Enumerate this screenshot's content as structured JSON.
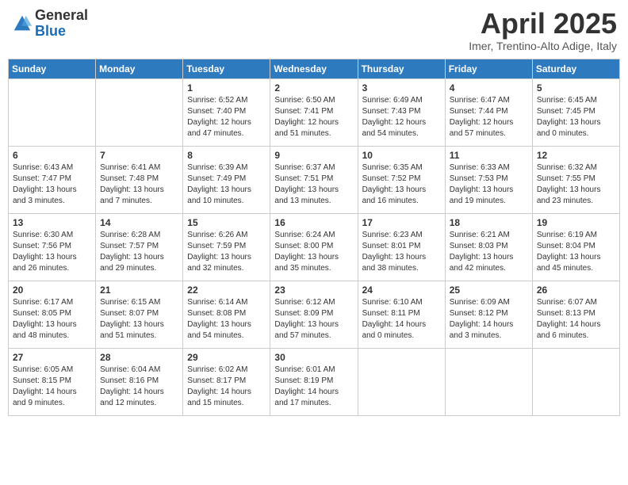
{
  "header": {
    "logo_general": "General",
    "logo_blue": "Blue",
    "month_title": "April 2025",
    "location": "Imer, Trentino-Alto Adige, Italy"
  },
  "days_of_week": [
    "Sunday",
    "Monday",
    "Tuesday",
    "Wednesday",
    "Thursday",
    "Friday",
    "Saturday"
  ],
  "weeks": [
    [
      {
        "day": "",
        "info": ""
      },
      {
        "day": "",
        "info": ""
      },
      {
        "day": "1",
        "info": "Sunrise: 6:52 AM\nSunset: 7:40 PM\nDaylight: 12 hours and 47 minutes."
      },
      {
        "day": "2",
        "info": "Sunrise: 6:50 AM\nSunset: 7:41 PM\nDaylight: 12 hours and 51 minutes."
      },
      {
        "day": "3",
        "info": "Sunrise: 6:49 AM\nSunset: 7:43 PM\nDaylight: 12 hours and 54 minutes."
      },
      {
        "day": "4",
        "info": "Sunrise: 6:47 AM\nSunset: 7:44 PM\nDaylight: 12 hours and 57 minutes."
      },
      {
        "day": "5",
        "info": "Sunrise: 6:45 AM\nSunset: 7:45 PM\nDaylight: 13 hours and 0 minutes."
      }
    ],
    [
      {
        "day": "6",
        "info": "Sunrise: 6:43 AM\nSunset: 7:47 PM\nDaylight: 13 hours and 3 minutes."
      },
      {
        "day": "7",
        "info": "Sunrise: 6:41 AM\nSunset: 7:48 PM\nDaylight: 13 hours and 7 minutes."
      },
      {
        "day": "8",
        "info": "Sunrise: 6:39 AM\nSunset: 7:49 PM\nDaylight: 13 hours and 10 minutes."
      },
      {
        "day": "9",
        "info": "Sunrise: 6:37 AM\nSunset: 7:51 PM\nDaylight: 13 hours and 13 minutes."
      },
      {
        "day": "10",
        "info": "Sunrise: 6:35 AM\nSunset: 7:52 PM\nDaylight: 13 hours and 16 minutes."
      },
      {
        "day": "11",
        "info": "Sunrise: 6:33 AM\nSunset: 7:53 PM\nDaylight: 13 hours and 19 minutes."
      },
      {
        "day": "12",
        "info": "Sunrise: 6:32 AM\nSunset: 7:55 PM\nDaylight: 13 hours and 23 minutes."
      }
    ],
    [
      {
        "day": "13",
        "info": "Sunrise: 6:30 AM\nSunset: 7:56 PM\nDaylight: 13 hours and 26 minutes."
      },
      {
        "day": "14",
        "info": "Sunrise: 6:28 AM\nSunset: 7:57 PM\nDaylight: 13 hours and 29 minutes."
      },
      {
        "day": "15",
        "info": "Sunrise: 6:26 AM\nSunset: 7:59 PM\nDaylight: 13 hours and 32 minutes."
      },
      {
        "day": "16",
        "info": "Sunrise: 6:24 AM\nSunset: 8:00 PM\nDaylight: 13 hours and 35 minutes."
      },
      {
        "day": "17",
        "info": "Sunrise: 6:23 AM\nSunset: 8:01 PM\nDaylight: 13 hours and 38 minutes."
      },
      {
        "day": "18",
        "info": "Sunrise: 6:21 AM\nSunset: 8:03 PM\nDaylight: 13 hours and 42 minutes."
      },
      {
        "day": "19",
        "info": "Sunrise: 6:19 AM\nSunset: 8:04 PM\nDaylight: 13 hours and 45 minutes."
      }
    ],
    [
      {
        "day": "20",
        "info": "Sunrise: 6:17 AM\nSunset: 8:05 PM\nDaylight: 13 hours and 48 minutes."
      },
      {
        "day": "21",
        "info": "Sunrise: 6:15 AM\nSunset: 8:07 PM\nDaylight: 13 hours and 51 minutes."
      },
      {
        "day": "22",
        "info": "Sunrise: 6:14 AM\nSunset: 8:08 PM\nDaylight: 13 hours and 54 minutes."
      },
      {
        "day": "23",
        "info": "Sunrise: 6:12 AM\nSunset: 8:09 PM\nDaylight: 13 hours and 57 minutes."
      },
      {
        "day": "24",
        "info": "Sunrise: 6:10 AM\nSunset: 8:11 PM\nDaylight: 14 hours and 0 minutes."
      },
      {
        "day": "25",
        "info": "Sunrise: 6:09 AM\nSunset: 8:12 PM\nDaylight: 14 hours and 3 minutes."
      },
      {
        "day": "26",
        "info": "Sunrise: 6:07 AM\nSunset: 8:13 PM\nDaylight: 14 hours and 6 minutes."
      }
    ],
    [
      {
        "day": "27",
        "info": "Sunrise: 6:05 AM\nSunset: 8:15 PM\nDaylight: 14 hours and 9 minutes."
      },
      {
        "day": "28",
        "info": "Sunrise: 6:04 AM\nSunset: 8:16 PM\nDaylight: 14 hours and 12 minutes."
      },
      {
        "day": "29",
        "info": "Sunrise: 6:02 AM\nSunset: 8:17 PM\nDaylight: 14 hours and 15 minutes."
      },
      {
        "day": "30",
        "info": "Sunrise: 6:01 AM\nSunset: 8:19 PM\nDaylight: 14 hours and 17 minutes."
      },
      {
        "day": "",
        "info": ""
      },
      {
        "day": "",
        "info": ""
      },
      {
        "day": "",
        "info": ""
      }
    ]
  ]
}
